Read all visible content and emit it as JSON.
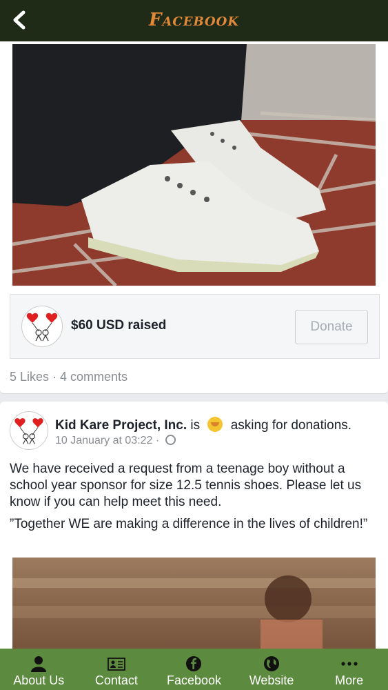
{
  "header": {
    "title": "Facebook",
    "back_icon": "back-chevron-icon"
  },
  "post1": {
    "fundraiser_amount": "$60 USD raised",
    "donate_label": "Donate",
    "reactions": "5 Likes · 4 comments"
  },
  "post2": {
    "page_name": "Kid Kare Project, Inc.",
    "is_word": "is",
    "activity": "asking for donations.",
    "timestamp": "10 January at 03:22 ·",
    "paragraph1": "We have received a request from a teenage boy without a school year sponsor for size 12.5 tennis shoes. Please let us know if you can help meet this need.",
    "paragraph2": "”Together WE are making a difference in the lives of children!”"
  },
  "tabs": [
    {
      "label": "About Us",
      "icon": "person-icon"
    },
    {
      "label": "Contact",
      "icon": "contact-card-icon"
    },
    {
      "label": "Facebook",
      "icon": "facebook-icon"
    },
    {
      "label": "Website",
      "icon": "globe-icon"
    },
    {
      "label": "More",
      "icon": "more-dots-icon"
    }
  ],
  "colors": {
    "header_bg": "#1f2a17",
    "title": "#e0893a",
    "tabbar_bg": "#5c8a3e"
  }
}
